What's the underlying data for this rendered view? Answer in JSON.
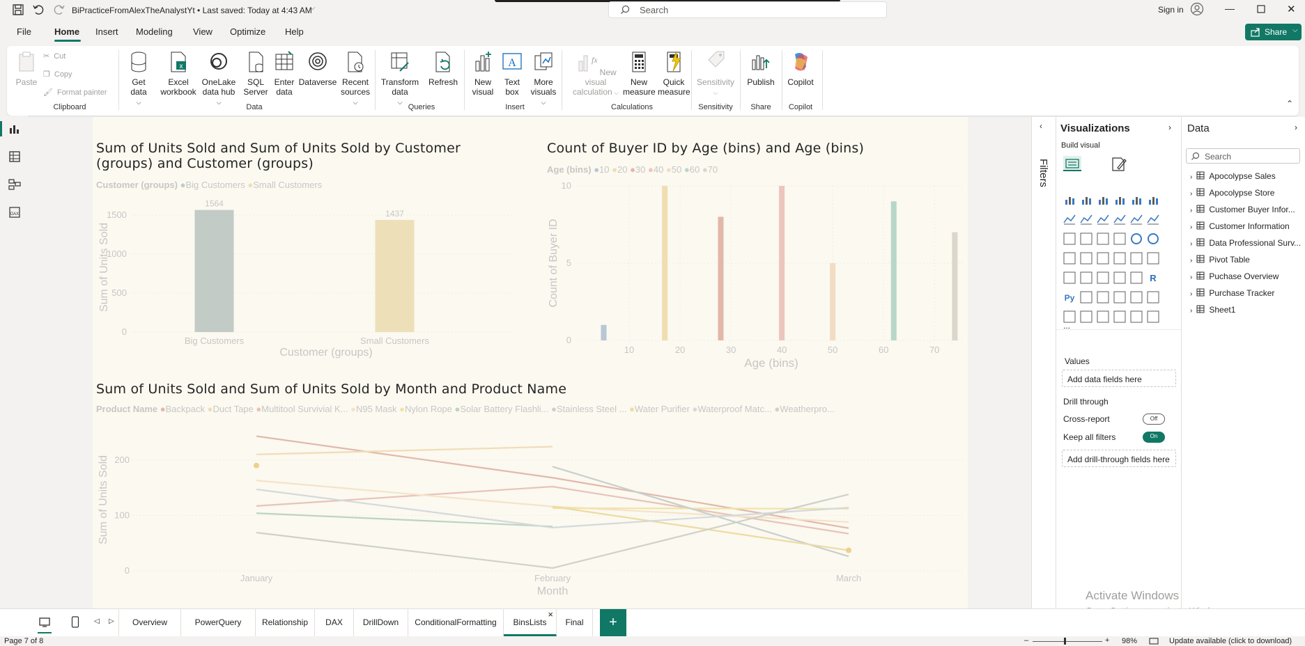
{
  "titlebar": {
    "doc_title": "BiPracticeFromAlexTheAnalystYt • Last saved: Today at 4:43 AM",
    "search_placeholder": "Search",
    "sign_in": "Sign in",
    "share": "Share"
  },
  "menu": [
    "File",
    "Home",
    "Insert",
    "Modeling",
    "View",
    "Optimize",
    "Help"
  ],
  "ribbon": {
    "clipboard": {
      "paste": "Paste",
      "cut": "Cut",
      "copy": "Copy",
      "format_painter": "Format painter",
      "group": "Clipboard"
    },
    "data": {
      "get_data": "Get data",
      "excel": "Excel workbook",
      "onelake": "OneLake data hub",
      "sql": "SQL Server",
      "enter": "Enter data",
      "dataverse": "Dataverse",
      "recent": "Recent sources",
      "group": "Data"
    },
    "queries": {
      "transform": "Transform data",
      "refresh": "Refresh",
      "group": "Queries"
    },
    "insert": {
      "new_visual": "New visual",
      "text_box": "Text box",
      "more_visuals": "More visuals",
      "group": "Insert"
    },
    "calculations": {
      "new_visual_calc": "New visual calculation",
      "new_measure": "New measure",
      "quick_measure": "Quick measure",
      "group": "Calculations"
    },
    "sensitivity": {
      "label": "Sensitivity",
      "group": "Sensitivity"
    },
    "share": {
      "publish": "Publish",
      "group": "Share"
    },
    "copilot": {
      "label": "Copilot",
      "group": "Copilot"
    }
  },
  "charts": {
    "bar_title": "Sum of Units Sold and Sum of Units Sold by Customer (groups) and Customer (groups)",
    "bar_legend_title": "Customer (groups)",
    "hist_title": "Count of Buyer ID by Age (bins) and Age (bins)",
    "hist_legend_title": "Age (bins)",
    "line_title": "Sum of Units Sold and Sum of Units Sold by Month and Product Name",
    "line_legend_title": "Product Name"
  },
  "chart_data": [
    {
      "type": "bar",
      "title": "Sum of Units Sold and Sum of Units Sold by Customer (groups) and Customer (groups)",
      "categories": [
        "Big Customers",
        "Small Customers"
      ],
      "values": [
        1564,
        1437
      ],
      "data_labels": [
        "1564",
        "1437"
      ],
      "colors": [
        "#c3cbc7",
        "#ede0b9"
      ],
      "legend": [
        "Big Customers",
        "Small Customers"
      ],
      "xlabel": "Customer (groups)",
      "ylabel": "Sum of Units Sold",
      "yticks": [
        "0",
        "500",
        "1000",
        "1500"
      ],
      "ylim": [
        0,
        1650
      ]
    },
    {
      "type": "bar",
      "title": "Count of Buyer ID by Age (bins) and Age (bins)",
      "x": [
        5,
        17,
        28,
        40,
        50,
        62,
        74
      ],
      "values": [
        1,
        10,
        8,
        10,
        5,
        9,
        7
      ],
      "colors": [
        "#b9c6d6",
        "#f0ddb2",
        "#e2b7aa",
        "#ecc5bd",
        "#f2dcc2",
        "#b7d7c9",
        "#dcd6cd"
      ],
      "legend": [
        "10",
        "20",
        "30",
        "40",
        "50",
        "60",
        "70"
      ],
      "xlabel": "Age (bins)",
      "ylabel": "Count of Buyer ID",
      "xticks": [
        "10",
        "20",
        "30",
        "40",
        "50",
        "60",
        "70"
      ],
      "yticks": [
        "0",
        "5",
        "10"
      ],
      "xlim": [
        0,
        76
      ],
      "ylim": [
        0,
        10
      ]
    },
    {
      "type": "line",
      "title": "Sum of Units Sold and Sum of Units Sold by Month and Product Name",
      "categories": [
        "January",
        "February",
        "March"
      ],
      "xlabel": "Month",
      "ylabel": "Sum of Units Sold",
      "yticks": [
        "0",
        "100",
        "200"
      ],
      "ylim": [
        0,
        260
      ],
      "legend": [
        "Backpack",
        "Duct Tape",
        "Multitool Survivial K...",
        "N95 Mask",
        "Nylon Rope",
        "Solar Battery Flashli...",
        "Stainless Steel ...",
        "Water Purifier",
        "Waterproof Matc...",
        "Weatherpro..."
      ],
      "series": [
        {
          "color": "#e2b8ac",
          "values": [
            243,
            168,
            77
          ]
        },
        {
          "color": "#f0dcb8",
          "values": [
            210,
            224,
            null
          ]
        },
        {
          "color": "#e7c3b8",
          "values": [
            117,
            152,
            67
          ]
        },
        {
          "color": "#f5e3c9",
          "values": [
            163,
            116,
            88
          ]
        },
        {
          "color": "#f2e2a8",
          "values": [
            null,
            113,
            112
          ]
        },
        {
          "color": "#bcd3c3",
          "values": [
            104,
            80,
            null
          ]
        },
        {
          "color": "#c9cfce",
          "values": [
            null,
            188,
            26
          ]
        },
        {
          "color": "#eddba0",
          "values": [
            null,
            116,
            37
          ]
        },
        {
          "color": "#d3d9db",
          "values": [
            147,
            78,
            114
          ]
        },
        {
          "color": "#cfd1ca",
          "values": [
            69,
            5,
            138
          ]
        }
      ],
      "points": [
        {
          "x": "January",
          "y": 190,
          "color": "#f0cf8c"
        },
        {
          "x": "March",
          "y": 37,
          "color": "#f0cf8c"
        }
      ]
    }
  ],
  "visualizations": {
    "title": "Visualizations",
    "build_visual": "Build visual",
    "values": "Values",
    "add_data_fields": "Add data fields here",
    "drill_through": "Drill through",
    "cross_report": "Cross-report",
    "cross_report_state": "Off",
    "keep_filters": "Keep all filters",
    "keep_filters_state": "On",
    "add_drill": "Add drill-through fields here",
    "more": "..."
  },
  "filters_label": "Filters",
  "data_pane": {
    "title": "Data",
    "search_placeholder": "Search",
    "tables": [
      "Apocolypse Sales",
      "Apocolypse Store",
      "Customer Buyer Infor...",
      "Customer Information",
      "Data Professional Surv...",
      "Pivot Table",
      "Puchase Overview",
      "Purchase Tracker",
      "Sheet1"
    ]
  },
  "page_tabs": [
    "Overview",
    "PowerQuery",
    "Relationship",
    "DAX",
    "DrillDown",
    "ConditionalFormatting",
    "BinsLists",
    "Final"
  ],
  "active_tab": "BinsLists",
  "activate_windows": {
    "line1": "Activate Windows",
    "line2": "Go to Settings to activate Windows."
  },
  "status": {
    "page": "Page 7 of 8",
    "zoom": "98%",
    "update": "Update available (click to download)"
  }
}
